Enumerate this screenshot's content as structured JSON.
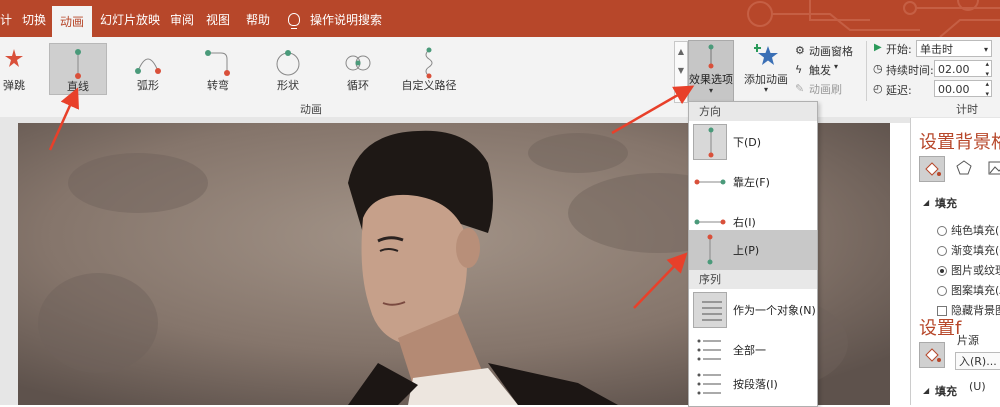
{
  "tabs": [
    {
      "label": "计",
      "active": false
    },
    {
      "label": "切换",
      "active": false
    },
    {
      "label": "动画",
      "active": true
    },
    {
      "label": "幻灯片放映",
      "active": false
    },
    {
      "label": "审阅",
      "active": false
    },
    {
      "label": "视图",
      "active": false
    },
    {
      "label": "帮助",
      "active": false
    }
  ],
  "help_search": "操作说明搜索",
  "animations": [
    {
      "label": "弹跳",
      "icon": "bounce-star-icon"
    },
    {
      "label": "直线",
      "icon": "line-path-icon",
      "selected": true
    },
    {
      "label": "弧形",
      "icon": "arc-path-icon"
    },
    {
      "label": "转弯",
      "icon": "turn-path-icon"
    },
    {
      "label": "形状",
      "icon": "shape-path-icon"
    },
    {
      "label": "循环",
      "icon": "loop-path-icon"
    },
    {
      "label": "自定义路径",
      "icon": "custom-path-icon"
    }
  ],
  "group_animation": "动画",
  "effect_options": "效果选项",
  "add_animation": "添加动画",
  "animation_pane": "动画窗格",
  "trigger": "触发",
  "animation_painter": "动画刷",
  "timing": {
    "start_label": "开始:",
    "start_value": "单击时",
    "duration_label": "持续时间:",
    "duration_value": "02.00",
    "delay_label": "延迟:",
    "delay_value": "00.00",
    "group_label": "计时"
  },
  "dropdown": {
    "direction_header": "方向",
    "directions": [
      {
        "label": "下(D)",
        "selected": false
      },
      {
        "label": "靠左(F)",
        "selected": false
      },
      {
        "label": "右(I)",
        "selected": false
      },
      {
        "label": "上(P)",
        "selected": true
      }
    ],
    "sequence_header": "序列",
    "sequences": [
      {
        "label": "作为一个对象(N)"
      },
      {
        "label": "全部一"
      },
      {
        "label": "按段落(I)"
      }
    ]
  },
  "format_panel": {
    "title": "设置背景格",
    "fill_section": "填充",
    "options": [
      {
        "label": "纯色填充(S",
        "checked": false
      },
      {
        "label": "渐变填充(G",
        "checked": false
      },
      {
        "label": "图片或纹理",
        "checked": true
      },
      {
        "label": "图案填充(A",
        "checked": false
      }
    ],
    "hide_bg": "隐藏背景图",
    "title2": "设置f",
    "source": "片源",
    "insert": "入(R)...",
    "fill2": "填充",
    "u": "(U)"
  },
  "colors": {
    "accent": "#b7472a",
    "arrow": "#e8402a",
    "path_green": "#4a9a7a",
    "path_red": "#d9503a"
  }
}
